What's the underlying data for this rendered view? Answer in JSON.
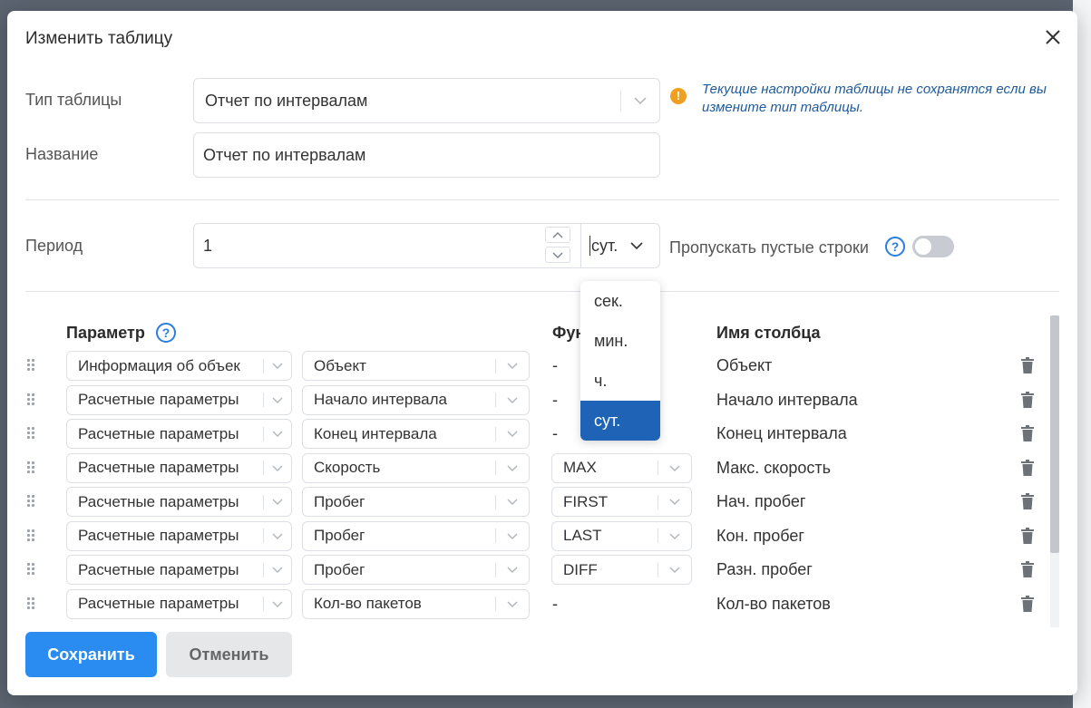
{
  "modal": {
    "title": "Изменить таблицу"
  },
  "form": {
    "type_label": "Тип таблицы",
    "type_value": "Отчет по интервалам",
    "warning": "Текущие настройки таблицы не сохранятся если вы измените тип таблицы.",
    "name_label": "Название",
    "name_value": "Отчет по интервалам",
    "period_label": "Период",
    "period_value": "1",
    "period_unit": "сут.",
    "skip_empty_label": "Пропускать пустые строки",
    "skip_empty_on": false
  },
  "unit_dropdown": {
    "options": [
      "сек.",
      "мин.",
      "ч.",
      "сут."
    ],
    "selected": "сут."
  },
  "table": {
    "headers": {
      "param": "Параметр",
      "func": "Фун",
      "colname": "Имя столбца"
    },
    "rows": [
      {
        "group": "Информация об объек",
        "param": "Объект",
        "func": "-",
        "func_select": false,
        "colname": "Объект"
      },
      {
        "group": "Расчетные параметры",
        "param": "Начало интервала",
        "func": "-",
        "func_select": false,
        "colname": "Начало интервала"
      },
      {
        "group": "Расчетные параметры",
        "param": "Конец интервала",
        "func": "-",
        "func_select": false,
        "colname": "Конец интервала"
      },
      {
        "group": "Расчетные параметры",
        "param": "Скорость",
        "func": "MAX",
        "func_select": true,
        "colname": "Макс. скорость"
      },
      {
        "group": "Расчетные параметры",
        "param": "Пробег",
        "func": "FIRST",
        "func_select": true,
        "colname": "Нач. пробег"
      },
      {
        "group": "Расчетные параметры",
        "param": "Пробег",
        "func": "LAST",
        "func_select": true,
        "colname": "Кон. пробег"
      },
      {
        "group": "Расчетные параметры",
        "param": "Пробег",
        "func": "DIFF",
        "func_select": true,
        "colname": "Разн. пробег"
      },
      {
        "group": "Расчетные параметры",
        "param": "Кол-во пакетов",
        "func": "-",
        "func_select": false,
        "colname": "Кол-во пакетов"
      }
    ]
  },
  "buttons": {
    "save": "Сохранить",
    "cancel": "Отменить"
  },
  "colors": {
    "primary": "#2a8cf0",
    "selected_option": "#1f63b7",
    "warning": "#f0a020",
    "help": "#2a7de1"
  }
}
